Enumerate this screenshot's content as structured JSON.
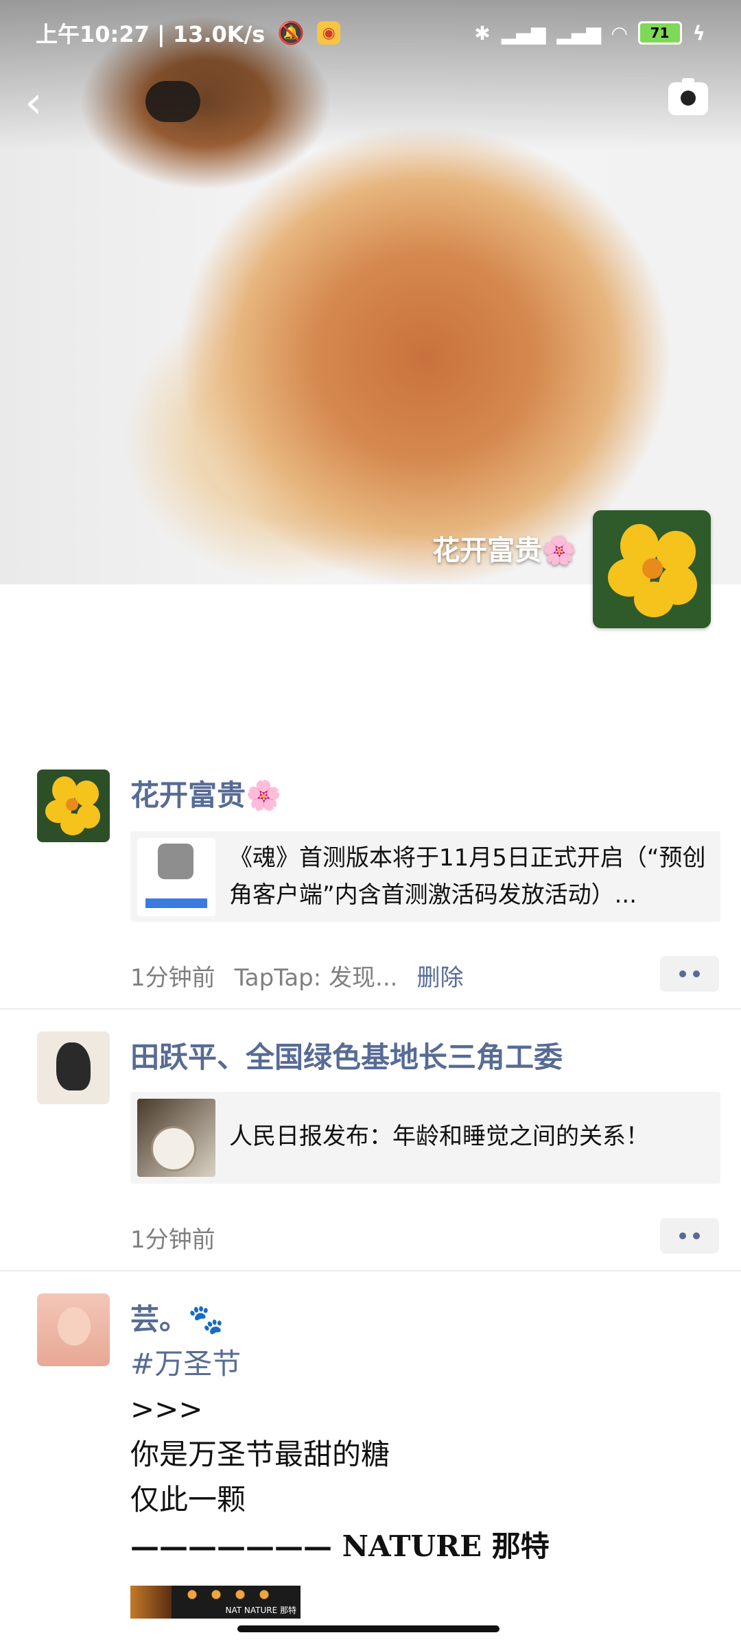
{
  "status_bar": {
    "time_speed": "上午10:27 | 13.0K/s",
    "battery": "71"
  },
  "cover": {
    "username": "花开富贵🌸"
  },
  "posts": [
    {
      "nickname": "花开富贵🌸",
      "card_title": "《魂》首测版本将于11月5日正式开启（“预创角客户端”内含首测激活码发放活动）...",
      "time": "1分钟前",
      "source": "TapTap: 发现...",
      "delete_label": "删除"
    },
    {
      "nickname": "田跃平、全国绿色基地长三角工委",
      "card_title": "人民日报发布：年龄和睡觉之间的关系！",
      "time": "1分钟前"
    },
    {
      "nickname": "芸。🐾",
      "hashtag": "#万圣节",
      "lines": [
        ">>>",
        "你是万圣节最甜的糖",
        "仅此一颗"
      ],
      "signature": "——————— NATURE 那特",
      "image_caption": "NAT NATURE 那特"
    }
  ]
}
